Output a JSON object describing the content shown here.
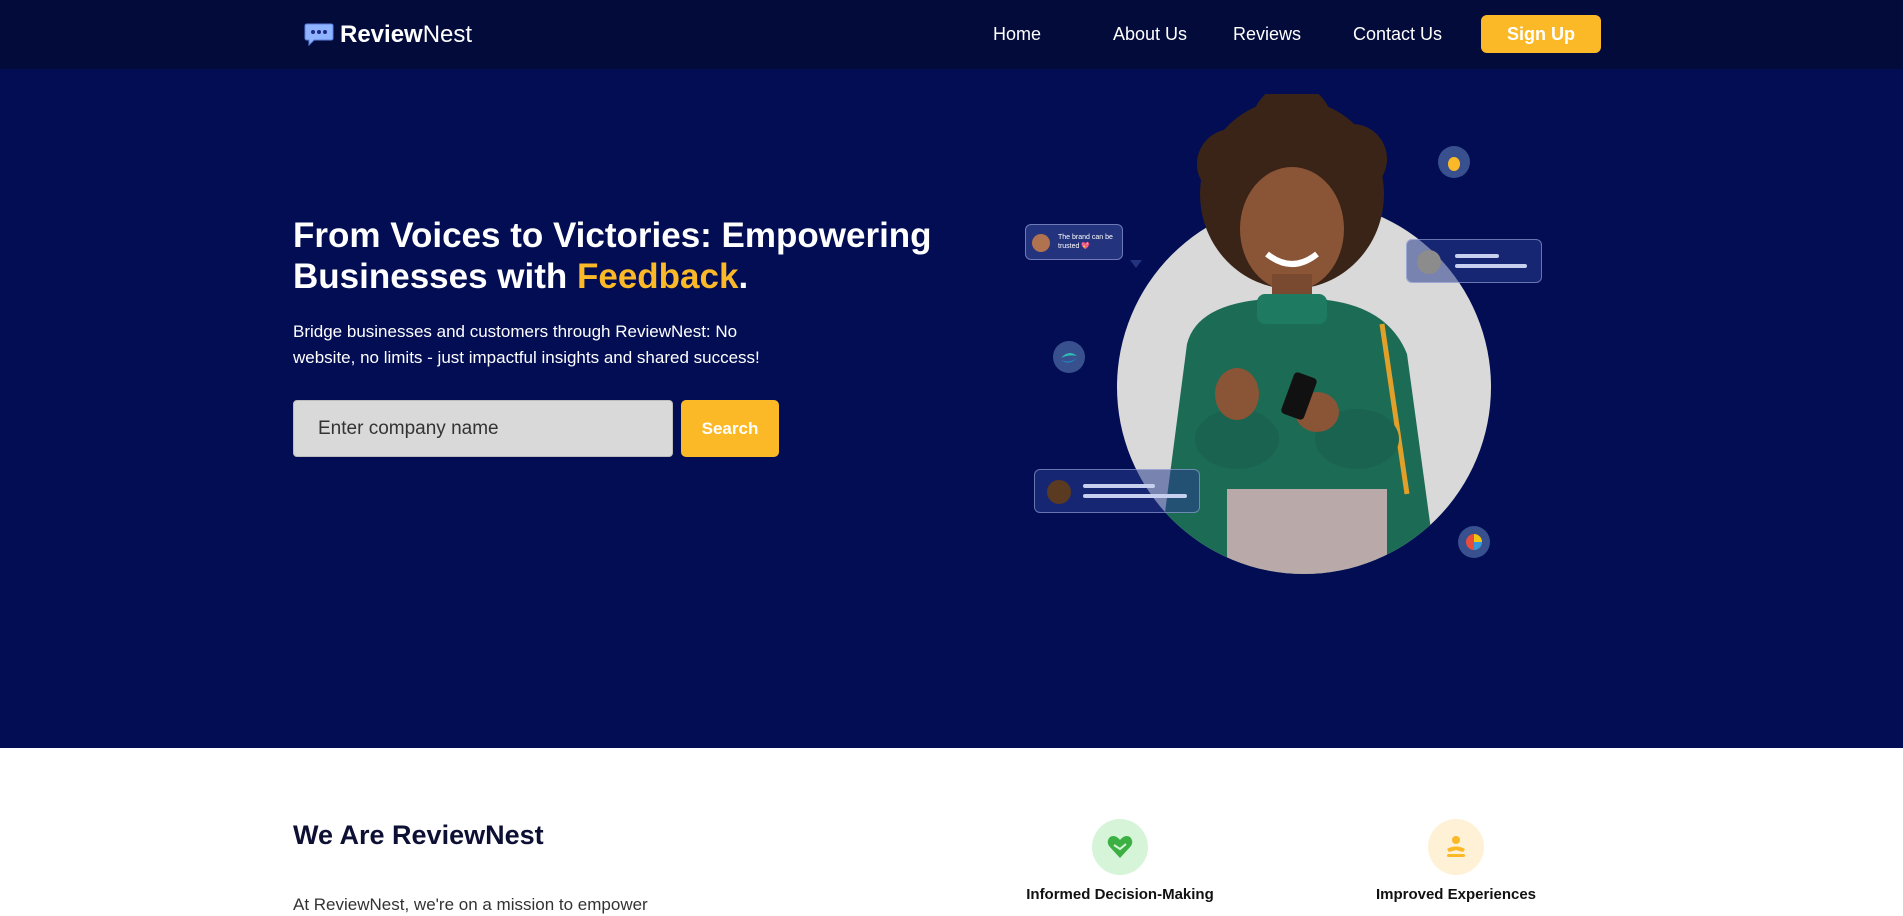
{
  "nav": {
    "brand_bold": "Review",
    "brand_light": "Nest",
    "links": [
      "Home",
      "About Us",
      "Reviews",
      "Contact Us"
    ],
    "signup_label": "Sign Up"
  },
  "hero": {
    "title_main": "From Voices to Victories: Empowering Businesses with ",
    "title_accent": "Feedback",
    "title_end": ".",
    "subtitle": "Bridge businesses and customers through ReviewNest: No website, no limits - just impactful insights and shared success!",
    "search": {
      "placeholder": "Enter company name",
      "button_label": "Search"
    },
    "bubble_text": "The brand can be trusted 💖"
  },
  "about": {
    "title": "We Are ReviewNest",
    "text": "At ReviewNest, we're on a mission to empower",
    "features": [
      "Informed Decision-Making",
      "Improved Experiences"
    ]
  },
  "colors": {
    "nav_bg": "#030b3b",
    "hero_bg": "#020d54",
    "accent": "#fbb928"
  }
}
